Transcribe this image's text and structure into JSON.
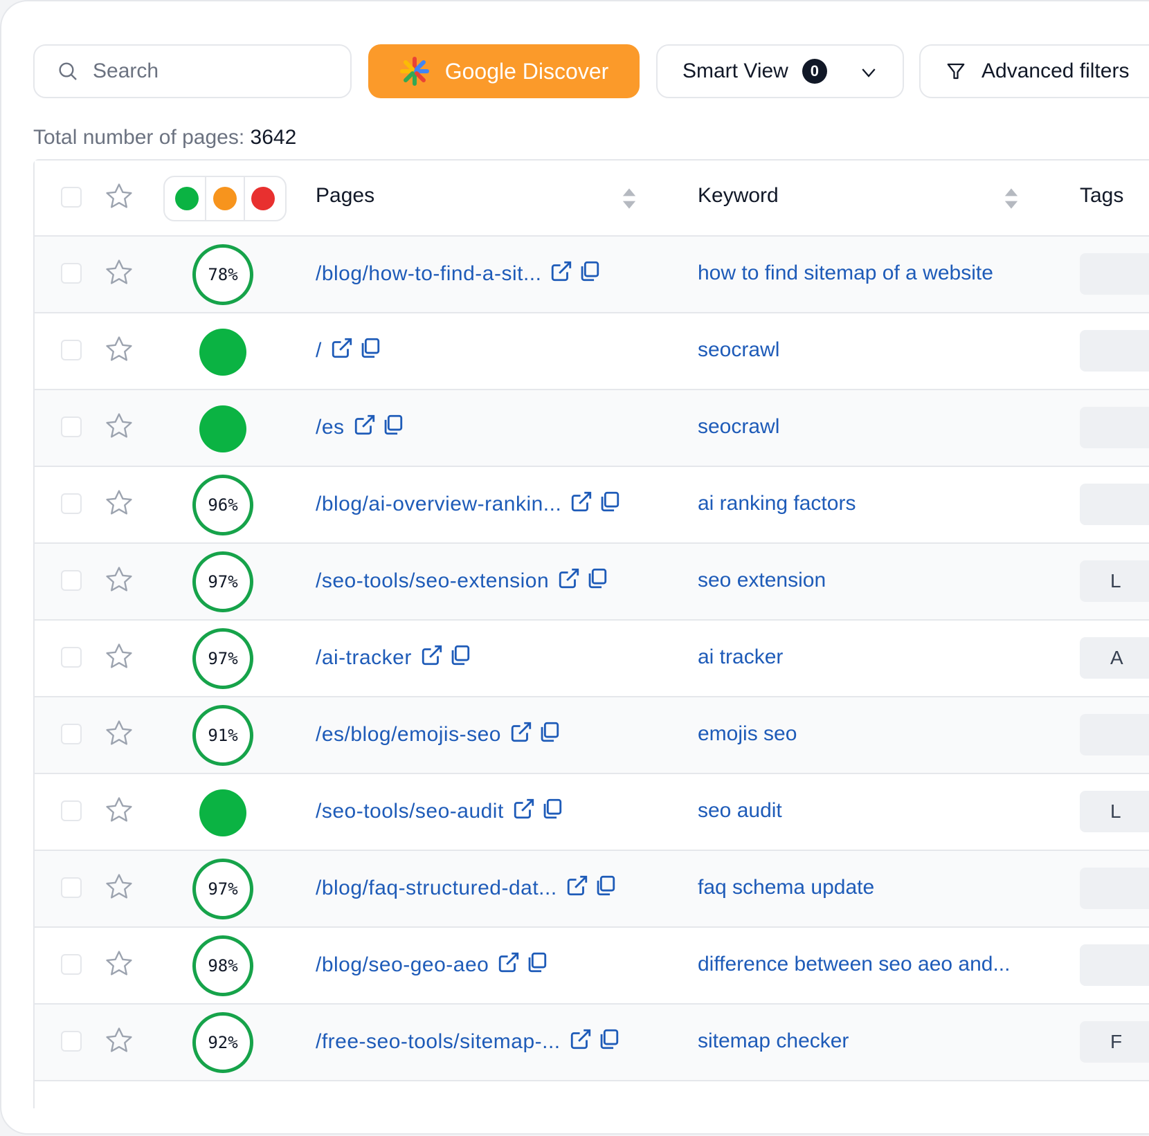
{
  "toolbar": {
    "search_placeholder": "Search",
    "google_discover_label": "Google Discover",
    "smart_view_label": "Smart View",
    "smart_view_count": "0",
    "advanced_filters_label": "Advanced filters"
  },
  "summary": {
    "total_label": "Total number of pages:",
    "total_value": "3642"
  },
  "colors": {
    "accent_orange": "#fb9a2a",
    "good_green": "#0bb343",
    "warn_orange": "#f7941d",
    "bad_red": "#e8302f",
    "link_blue": "#1e5bb8"
  },
  "table": {
    "columns": {
      "pages": "Pages",
      "keyword": "Keyword",
      "tags": "Tags"
    },
    "rows": [
      {
        "score": "78%",
        "page": "/blog/how-to-find-a-sit...",
        "keyword": "how to find sitemap of a website",
        "tag": ""
      },
      {
        "score": "",
        "page": "/",
        "keyword": "seocrawl",
        "tag": ""
      },
      {
        "score": "",
        "page": "/es",
        "keyword": "seocrawl",
        "tag": ""
      },
      {
        "score": "96%",
        "page": "/blog/ai-overview-rankin...",
        "keyword": "ai ranking factors",
        "tag": ""
      },
      {
        "score": "97%",
        "page": "/seo-tools/seo-extension",
        "keyword": "seo extension",
        "tag": "L"
      },
      {
        "score": "97%",
        "page": "/ai-tracker",
        "keyword": "ai tracker",
        "tag": "A"
      },
      {
        "score": "91%",
        "page": "/es/blog/emojis-seo",
        "keyword": "emojis seo",
        "tag": ""
      },
      {
        "score": "",
        "page": "/seo-tools/seo-audit",
        "keyword": "seo audit",
        "tag": "L"
      },
      {
        "score": "97%",
        "page": "/blog/faq-structured-dat...",
        "keyword": "faq schema update",
        "tag": ""
      },
      {
        "score": "98%",
        "page": "/blog/seo-geo-aeo",
        "keyword": "difference between seo aeo and...",
        "tag": ""
      },
      {
        "score": "92%",
        "page": "/free-seo-tools/sitemap-...",
        "keyword": "sitemap checker",
        "tag": "F"
      }
    ]
  }
}
